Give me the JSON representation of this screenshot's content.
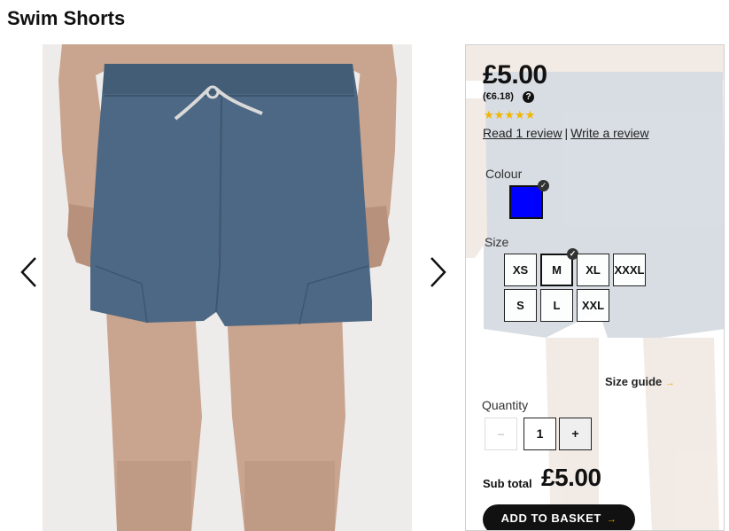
{
  "product": {
    "title": "Swim Shorts",
    "price": "£5.00",
    "price_alt": "(€6.18)",
    "help_icon_glyph": "?",
    "rating_stars": "★★★★★",
    "rating": 5,
    "read_review_link": "Read 1 review",
    "review_separator": "|",
    "write_review_link": "Write a review"
  },
  "colour": {
    "label": "Colour",
    "selected_color": "#0000ff",
    "check_glyph": "✓"
  },
  "size": {
    "label": "Size",
    "options": [
      "XS",
      "M",
      "XL",
      "XXXL",
      "S",
      "L",
      "XXL"
    ],
    "selected": "M",
    "guide_link": "Size guide",
    "guide_arrow": "→"
  },
  "quantity": {
    "label": "Quantity",
    "minus_label": "–",
    "value": "1",
    "plus_label": "+"
  },
  "subtotal": {
    "label": "Sub total",
    "value": "£5.00"
  },
  "basket": {
    "button_label": "ADD TO BASKET",
    "arrow": "→"
  },
  "gallery": {
    "prev_icon": "chevron-left-icon",
    "next_icon": "chevron-right-icon"
  },
  "colors": {
    "shorts": "#4d6884",
    "skin": "#c9a48e",
    "star": "#f2b600",
    "accent_arrow": "#f2a800"
  }
}
